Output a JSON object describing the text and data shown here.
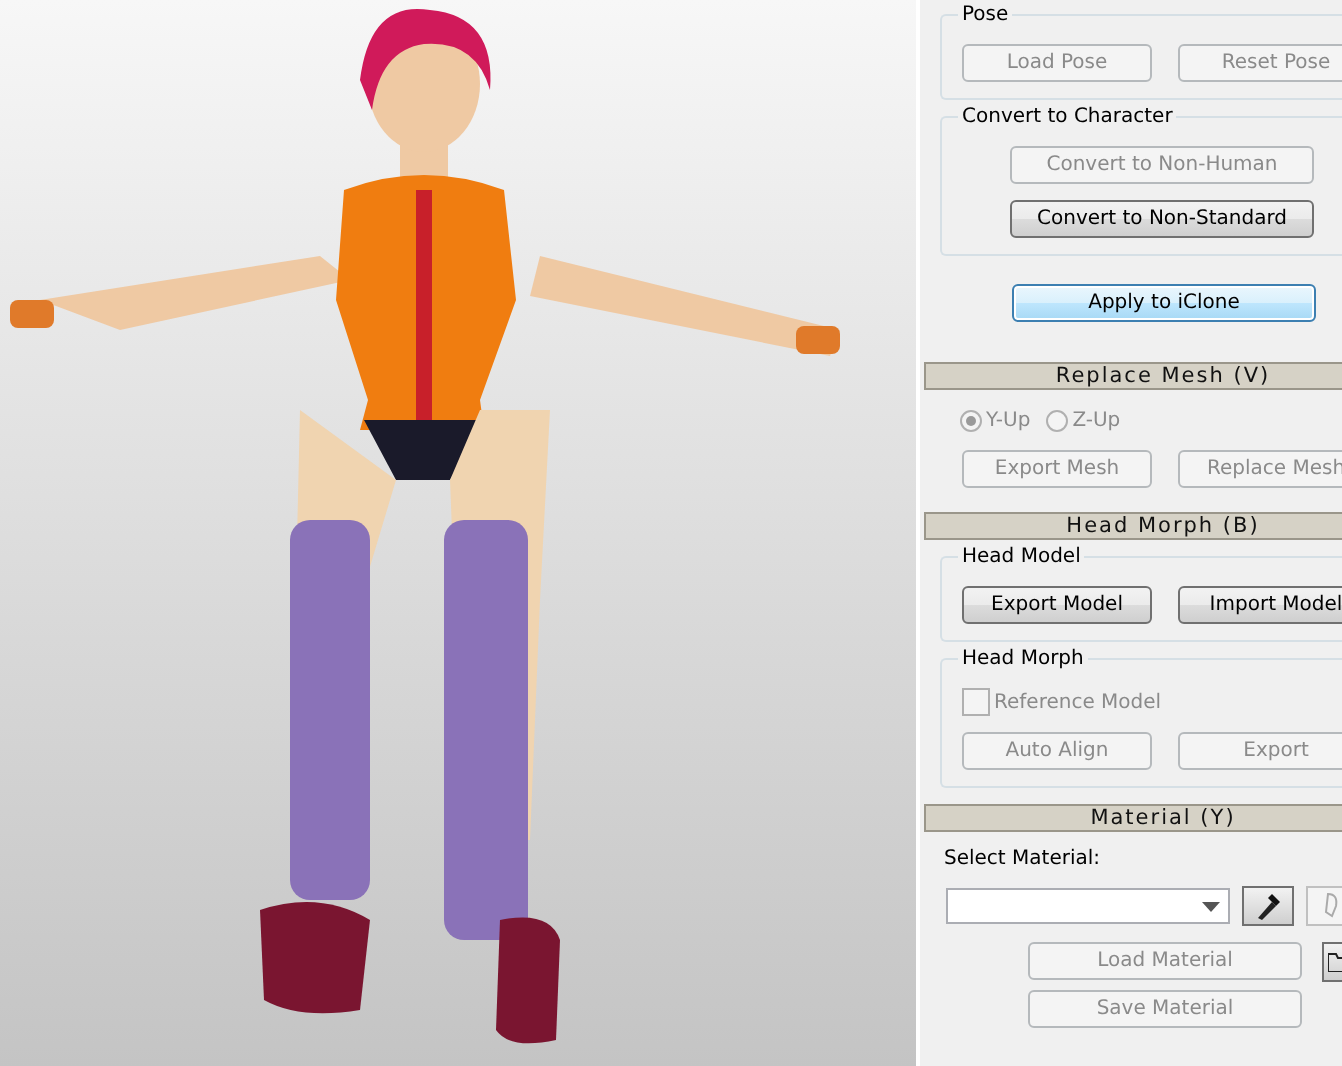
{
  "panel": {
    "blocks": [
      {
        "kind": "group",
        "title": "Pose",
        "rows": [
          {
            "kind": "buttons",
            "buttons": [
              {
                "label": "Load Pose",
                "disabled": true,
                "focused": false
              },
              {
                "label": "Reset Pose",
                "disabled": true,
                "focused": false
              }
            ]
          }
        ]
      },
      {
        "kind": "group",
        "title": "Convert to Character",
        "rows": [
          {
            "kind": "wide-button",
            "button": {
              "label": "Convert to Non-Human",
              "disabled": true,
              "focused": false
            }
          },
          {
            "kind": "wide-button",
            "button": {
              "label": "Convert to Non-Standard",
              "disabled": false,
              "focused": false
            }
          }
        ]
      },
      {
        "kind": "wide-button",
        "button": {
          "label": "Apply to iClone",
          "disabled": false,
          "focused": true
        }
      },
      {
        "kind": "header",
        "title": "Replace Mesh (V)"
      },
      {
        "kind": "radios",
        "options": [
          {
            "label": "Y-Up",
            "selected": true,
            "disabled": true
          },
          {
            "label": "Z-Up",
            "selected": false,
            "disabled": true
          }
        ]
      },
      {
        "kind": "buttons",
        "buttons": [
          {
            "label": "Export Mesh",
            "disabled": true,
            "focused": false
          },
          {
            "label": "Replace Mesh",
            "disabled": true,
            "focused": false
          }
        ]
      },
      {
        "kind": "header",
        "title": "Head Morph (B)"
      },
      {
        "kind": "group",
        "title": "Head Model",
        "rows": [
          {
            "kind": "buttons",
            "buttons": [
              {
                "label": "Export Model",
                "disabled": false,
                "focused": false
              },
              {
                "label": "Import Model",
                "disabled": false,
                "focused": false
              }
            ]
          }
        ]
      },
      {
        "kind": "group",
        "title": "Head Morph",
        "rows": [
          {
            "kind": "checkbox",
            "label": "Reference Model",
            "checked": false,
            "disabled": true
          },
          {
            "kind": "buttons",
            "buttons": [
              {
                "label": "Auto Align",
                "disabled": true,
                "focused": false
              },
              {
                "label": "Export",
                "disabled": true,
                "focused": false
              }
            ]
          }
        ]
      },
      {
        "kind": "header",
        "title": "Material (Y)"
      },
      {
        "kind": "label",
        "text": "Select Material:"
      },
      {
        "kind": "material-picker"
      },
      {
        "kind": "material-buttons",
        "buttons": [
          {
            "label": "Load Material",
            "disabled": true,
            "focused": false
          },
          {
            "label": "Save Material",
            "disabled": true,
            "focused": false
          }
        ]
      }
    ]
  }
}
